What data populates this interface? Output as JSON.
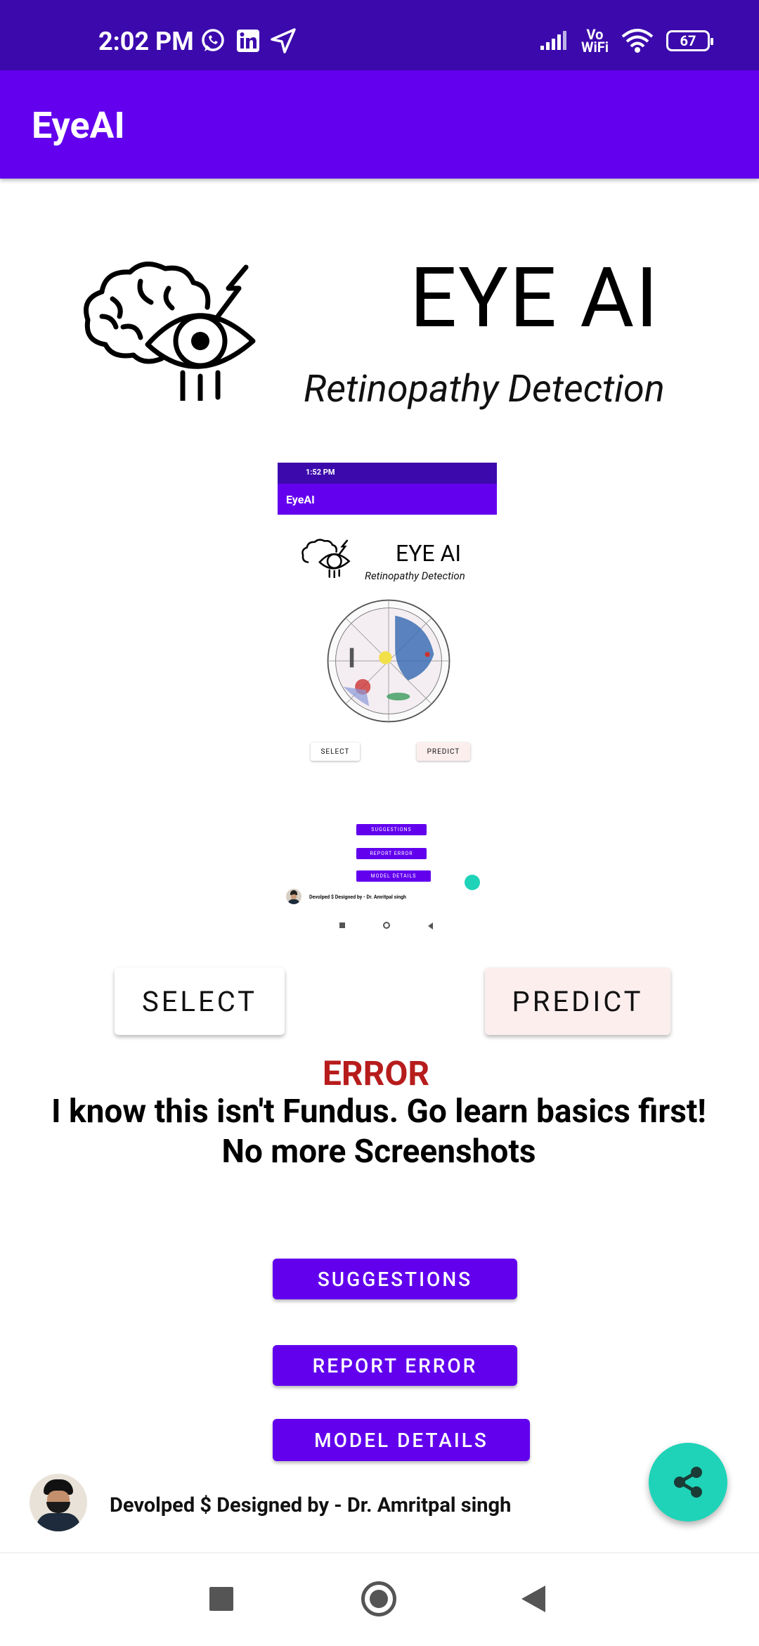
{
  "status_bar": {
    "time": "2:02 PM",
    "notification_icons": [
      "whatsapp-icon",
      "linkedin-icon",
      "location-arrow-icon"
    ],
    "network_label_top": "Vo",
    "network_label_bottom": "WiFi",
    "battery": "67"
  },
  "app_bar": {
    "title": "EyeAI"
  },
  "header": {
    "title": "EYE AI",
    "subtitle": "Retinopathy Detection"
  },
  "preview": {
    "status_time": "1:52 PM",
    "app_title": "EyeAI",
    "header_title": "EYE AI",
    "header_subtitle": "Retinopathy Detection",
    "select_label": "SELECT",
    "predict_label": "PREDICT",
    "suggestions_label": "SUGGESTIONS",
    "report_error_label": "REPORT ERROR",
    "model_details_label": "MODEL DETAILS",
    "footer_credit": "Devolped $ Designed by - Dr. Amritpal singh"
  },
  "actions": {
    "select_label": "SELECT",
    "predict_label": "PREDICT"
  },
  "result": {
    "title": "ERROR",
    "message": "I know this isn't Fundus. Go learn basics first! No more Screenshots"
  },
  "menu": {
    "suggestions_label": "SUGGESTIONS",
    "report_error_label": "REPORT ERROR",
    "model_details_label": "MODEL DETAILS"
  },
  "footer": {
    "credit": "Devolped $ Designed by - Dr. Amritpal singh"
  },
  "colors": {
    "status_bar": "#3c0aac",
    "primary": "#6200ee",
    "error": "#b71c1c",
    "fab": "#1ed3b8",
    "predict_bg": "#fdeeee"
  },
  "icons": {
    "fab": "share-icon",
    "nav": [
      "square-recents-icon",
      "circle-home-icon",
      "triangle-back-icon"
    ]
  }
}
